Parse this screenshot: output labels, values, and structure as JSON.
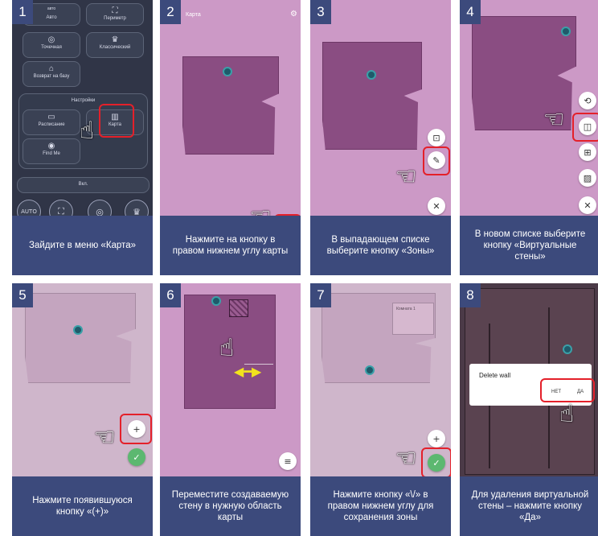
{
  "steps": [
    {
      "number": "1",
      "caption": "Зайдите в меню «Карта»"
    },
    {
      "number": "2",
      "caption": "Нажмите на кнопку в правом нижнем углу карты"
    },
    {
      "number": "3",
      "caption": "В выпадающем списке выберите кнопку «Зоны»"
    },
    {
      "number": "4",
      "caption": "В новом списке выберите кнопку «Виртуальные стены»"
    },
    {
      "number": "5",
      "caption": "Нажмите появившуюся кнопку «(+)»"
    },
    {
      "number": "6",
      "caption": "Переместите создаваемую стену в нужную область карты"
    },
    {
      "number": "7",
      "caption": "Нажмите кнопку «\\/» в правом нижнем углу для сохранения зоны"
    },
    {
      "number": "8",
      "caption": "Для удаления виртуальной стены – нажмите кнопку «Да»"
    }
  ],
  "app_menu": {
    "auto": "Авто",
    "auto_top": "авто",
    "perimeter": "Периметр",
    "spot": "Точечная",
    "classic": "Классический",
    "return": "Возврат на базу",
    "settings": "Настройки",
    "schedule": "Расписание",
    "map": "Карта",
    "find_me": "Find Me",
    "on": "Вкл.",
    "bottom_auto": "AUTO"
  },
  "map_screen": {
    "title": "Карта"
  },
  "zone_label": "Комната 1",
  "delete_dialog": {
    "title": "Delete wall",
    "no": "НЕТ",
    "yes": "ДА"
  },
  "colors": {
    "caption_bg": "#3c4a7c",
    "highlight": "#e4202a",
    "map_bg": "#cc99c6",
    "map_fill": "#8a4d82"
  }
}
